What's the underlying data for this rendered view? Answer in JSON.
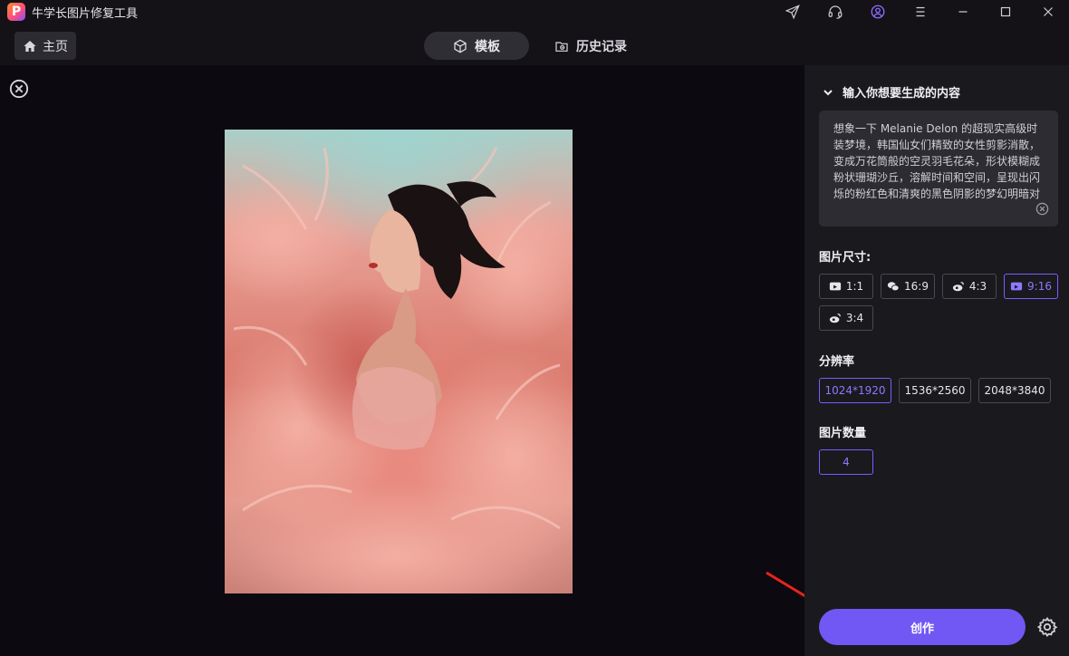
{
  "app": {
    "title": "牛学长图片修复工具",
    "logo_letter": "P"
  },
  "window_icons": [
    "send-icon",
    "headset-icon",
    "user-icon",
    "menu-icon",
    "minimize-icon",
    "maximize-icon",
    "close-icon"
  ],
  "nav": {
    "home_label": "主页",
    "tabs": [
      {
        "label": "模板",
        "active": true
      },
      {
        "label": "历史记录",
        "active": false
      }
    ]
  },
  "panel": {
    "prompt_header": "输入你想要生成的内容",
    "prompt_text": "想象一下 Melanie Delon 的超现实高级时装梦境，韩国仙女们精致的女性剪影消散，变成万花筒般的空灵羽毛花朵，形状模糊成粉状珊瑚沙丘，溶解时间和空间，呈现出闪烁的粉红色和清爽的黑色阴影的梦幻明暗对",
    "size_label": "图片尺寸:",
    "sizes": [
      {
        "label": "1:1",
        "icon": "media-icon",
        "selected": false
      },
      {
        "label": "16:9",
        "icon": "wechat-icon",
        "selected": false
      },
      {
        "label": "4:3",
        "icon": "weibo-icon",
        "selected": false
      },
      {
        "label": "9:16",
        "icon": "media-icon",
        "selected": true
      },
      {
        "label": "3:4",
        "icon": "weibo-icon",
        "selected": false
      }
    ],
    "resolution_label": "分辨率",
    "resolutions": [
      {
        "label": "1024*1920",
        "selected": true
      },
      {
        "label": "1536*2560",
        "selected": false
      },
      {
        "label": "2048*3840",
        "selected": false
      }
    ],
    "count_label": "图片数量",
    "count_value": "4",
    "create_label": "创作"
  },
  "colors": {
    "accent": "#7157f3",
    "selected_border": "#7a5cff",
    "pointer_arrow": "#e8231c"
  }
}
